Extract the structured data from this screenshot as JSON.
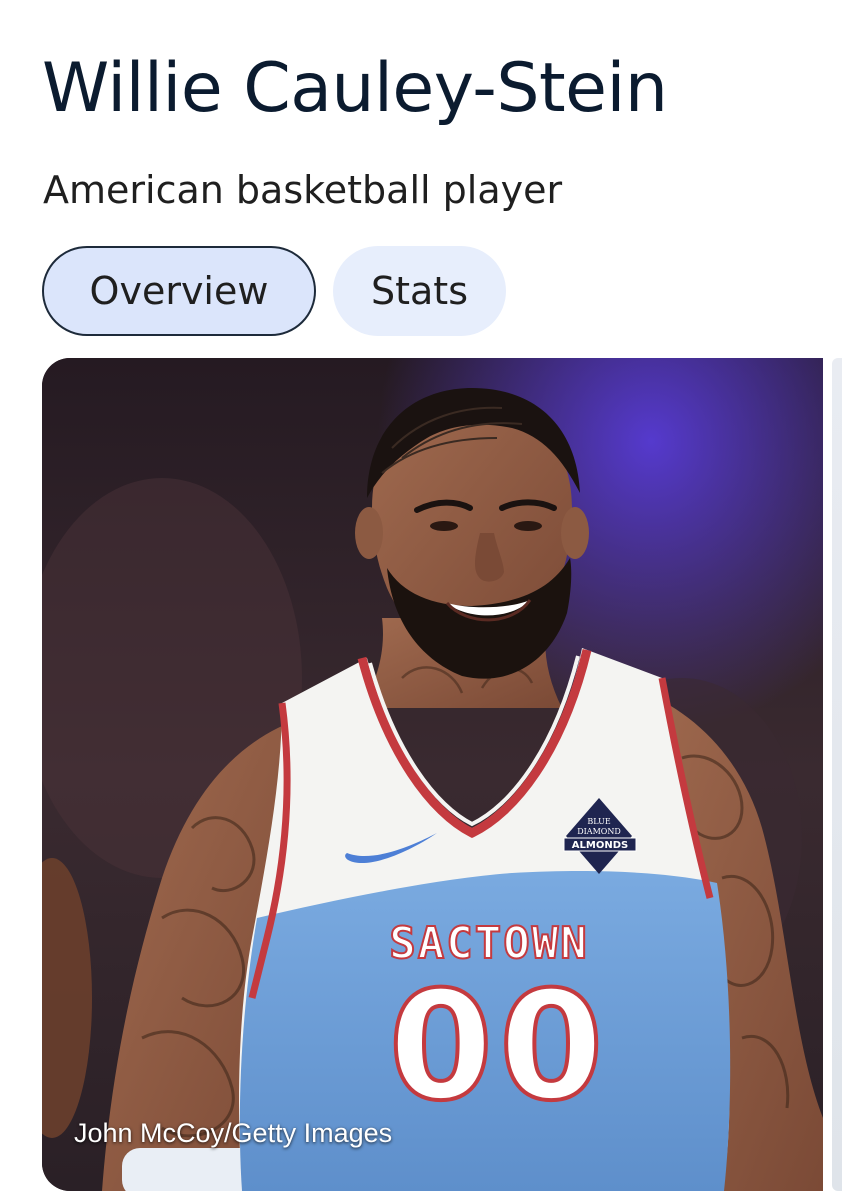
{
  "header": {
    "title": "Willie Cauley-Stein",
    "subtitle": "American basketball player"
  },
  "tabs": [
    {
      "label": "Overview",
      "selected": true
    },
    {
      "label": "Stats",
      "selected": false
    }
  ],
  "image": {
    "credit": "John McCoy/Getty Images",
    "jersey_text": "SACTOWN",
    "jersey_number": "00",
    "sponsor_patch_line1": "BLUE",
    "sponsor_patch_line2": "DIAMOND",
    "sponsor_patch_line3": "ALMONDS"
  },
  "colors": {
    "title": "#0b1b2f",
    "chip_selected_bg": "#dbe5fb",
    "chip_bg": "#e7eefc",
    "jersey_blue": "#6f9fd6",
    "jersey_trim": "#c43a3f"
  }
}
